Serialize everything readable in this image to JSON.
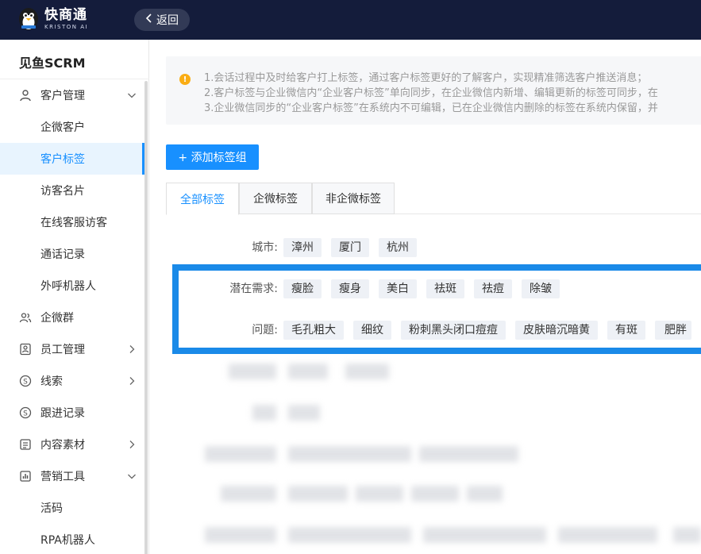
{
  "header": {
    "logo_title": "快商通",
    "logo_sub": "KRISTON AI",
    "back_label": "返回"
  },
  "sidebar": {
    "brand": "见鱼SCRM",
    "items": [
      {
        "label": "客户管理",
        "icon": "user-icon",
        "level": "top",
        "arrow": "down"
      },
      {
        "label": "企微客户",
        "level": "sub"
      },
      {
        "label": "客户标签",
        "level": "sub",
        "active": true
      },
      {
        "label": "访客名片",
        "level": "sub"
      },
      {
        "label": "在线客服访客",
        "level": "sub"
      },
      {
        "label": "通话记录",
        "level": "sub"
      },
      {
        "label": "外呼机器人",
        "level": "sub"
      },
      {
        "label": "企微群",
        "icon": "users-icon",
        "level": "top"
      },
      {
        "label": "员工管理",
        "icon": "employee-icon",
        "level": "top",
        "arrow": "right"
      },
      {
        "label": "线索",
        "icon": "clue-icon",
        "level": "top",
        "arrow": "right"
      },
      {
        "label": "跟进记录",
        "icon": "follow-icon",
        "level": "top"
      },
      {
        "label": "内容素材",
        "icon": "content-icon",
        "level": "top",
        "arrow": "right"
      },
      {
        "label": "营销工具",
        "icon": "chart-icon",
        "level": "top",
        "arrow": "down"
      },
      {
        "label": "活码",
        "level": "sub"
      },
      {
        "label": "RPA机器人",
        "level": "sub"
      }
    ]
  },
  "notice": {
    "lines": [
      "1.会话过程中及时给客户打上标签，通过客户标签更好的了解客户，实现精准筛选客户推送消息；",
      "2.客户标签与企业微信内“企业客户标签”单向同步，在企业微信内新增、编辑更新的标签可同步，在",
      "3.企业微信同步的“企业客户标签”在系统内不可编辑，已在企业微信内删除的标签在系统内保留，并"
    ]
  },
  "actions": {
    "add_group": "+ 添加标签组"
  },
  "tabs": [
    {
      "label": "全部标签",
      "active": true
    },
    {
      "label": "企微标签"
    },
    {
      "label": "非企微标签"
    }
  ],
  "tag_groups": [
    {
      "label": "城市:",
      "tags": [
        "漳州",
        "厦门",
        "杭州"
      ]
    },
    {
      "label": "潜在需求:",
      "tags": [
        "瘦脸",
        "瘦身",
        "美白",
        "祛斑",
        "祛痘",
        "除皱"
      ]
    },
    {
      "label": "问题:",
      "tags": [
        "毛孔粗大",
        "细纹",
        "粉刺黑头闭口痘痘",
        "皮肤暗沉暗黄",
        "有斑",
        "肥胖"
      ]
    }
  ],
  "colors": {
    "header_bg": "#141c3b",
    "primary": "#1890ff",
    "highlight_border": "#1a8ae8",
    "warning": "#faad14"
  }
}
